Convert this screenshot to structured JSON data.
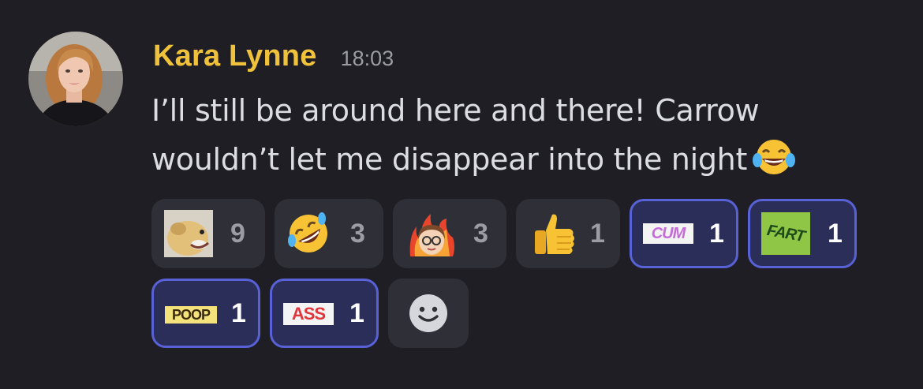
{
  "message": {
    "username": "Kara Lynne",
    "username_color": "#f0c23b",
    "timestamp": "18:03",
    "text_line1": "I’ll still be around here and there! Carrow",
    "text_line2": "wouldn’t let me disappear into the night",
    "inline_emoji": "joy-emoji"
  },
  "reactions": [
    {
      "emoji": "dog-emoji",
      "count": "9",
      "active": false
    },
    {
      "emoji": "rolling-on-floor-laughing-emoji",
      "count": "3",
      "active": false
    },
    {
      "emoji": "avatar-fire-emoji",
      "count": "3",
      "active": false
    },
    {
      "emoji": "thumbs-up-emoji",
      "count": "1",
      "active": false
    },
    {
      "emoji": "cum-text-emoji",
      "text": "CUM",
      "count": "1",
      "active": true
    },
    {
      "emoji": "fart-text-emoji",
      "text": "FART",
      "count": "1",
      "active": true
    },
    {
      "emoji": "poop-text-emoji",
      "text": "POOP",
      "count": "1",
      "active": true
    },
    {
      "emoji": "ass-text-emoji",
      "text": "ASS",
      "count": "1",
      "active": true
    },
    {
      "emoji": "add-reaction-icon"
    }
  ],
  "colors": {
    "background": "#1e1e24",
    "pill": "#2f3037",
    "pill_active": "#2c2e5a",
    "pill_active_border": "#5861d6",
    "timestamp": "#9b9ca4"
  }
}
